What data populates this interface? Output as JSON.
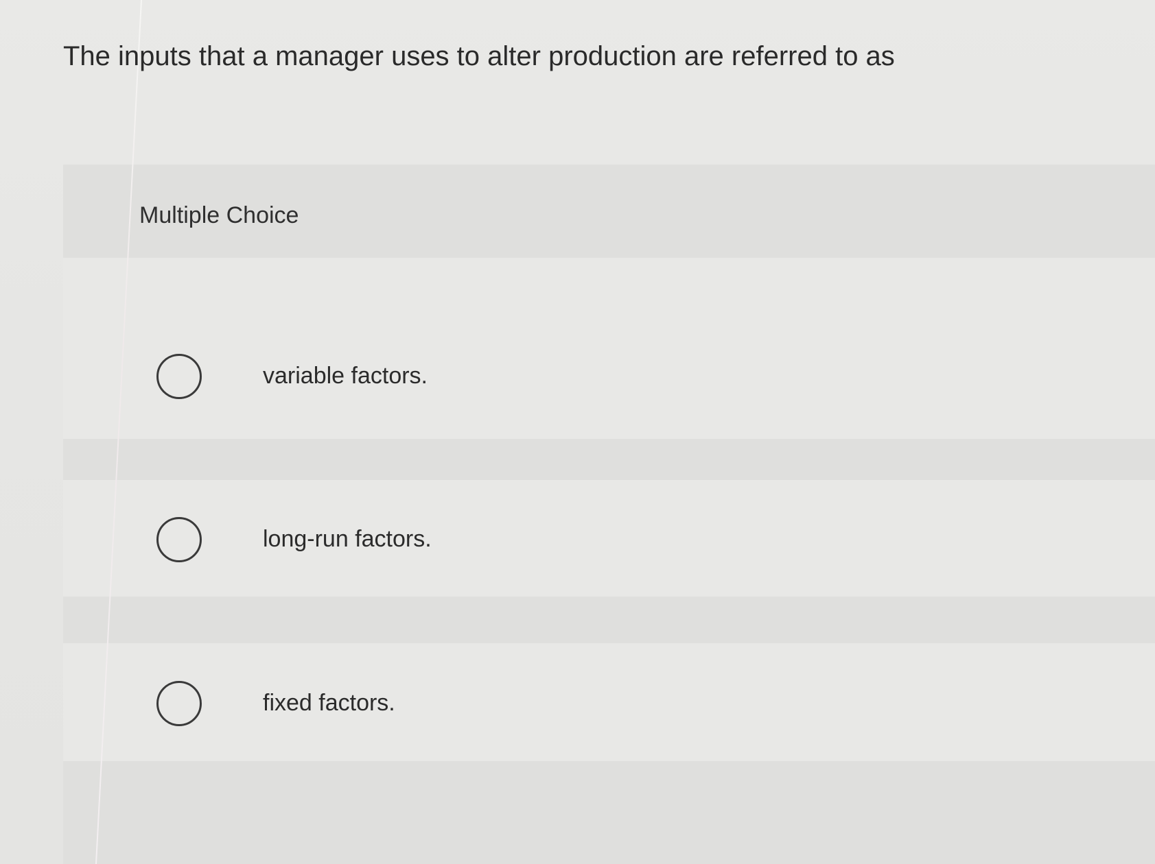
{
  "question": {
    "text": "The inputs that a manager uses to alter production are referred to as"
  },
  "section": {
    "label": "Multiple Choice"
  },
  "options": [
    {
      "label": "variable factors.",
      "selected": false
    },
    {
      "label": "long-run factors.",
      "selected": false
    },
    {
      "label": "fixed factors.",
      "selected": false
    }
  ]
}
